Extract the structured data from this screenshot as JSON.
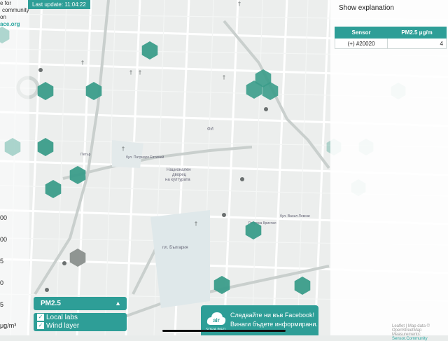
{
  "intro": {
    "line1": "e for",
    "line2": "community",
    "line3": "on",
    "link": "ace.org"
  },
  "last_update": "Last update: 11:04:22",
  "scale": {
    "tick1": "00",
    "tick2": "00",
    "tick3": "5",
    "tick4": "0",
    "tick5": "5",
    "unit": "μg/m³"
  },
  "panel": {
    "show_explanation": "Show explanation",
    "columns": [
      "Sensor",
      "PM2.5 μg/m"
    ],
    "rows": [
      {
        "sensor": "(+) #20020",
        "value": "4"
      }
    ]
  },
  "controls": {
    "pm_select": "PM2.5",
    "pm_arrow": "▲",
    "local_labs": "Local labs",
    "wind_layer": "Wind layer",
    "check_glyph": "✓"
  },
  "facebook": {
    "line1": "Следвайте ни във Facebook!",
    "line2": "Винаги бъдете информирани.",
    "logo_text": "SOFIA.INFO",
    "logo_glyph": "air"
  },
  "attribution": {
    "text1": "Leaflet | Map data © OpenStreetMap",
    "text2": "Measurements: ",
    "source": "Sensor.Community"
  },
  "map_labels": {
    "palace1": "Национален",
    "palace2": "дворец",
    "palace3": "на културата",
    "square": "пл. България",
    "petar": "Петър",
    "boulevard": "бул. Патриарх Евтимий",
    "vasil": "бул. Васил Левски",
    "fi": "ФИ",
    "gardens": "Градина Кристал"
  },
  "colors": {
    "accent": "#2e9e97",
    "hex_green": "#3b9c8a",
    "hex_grey": "#8a8f8d"
  }
}
